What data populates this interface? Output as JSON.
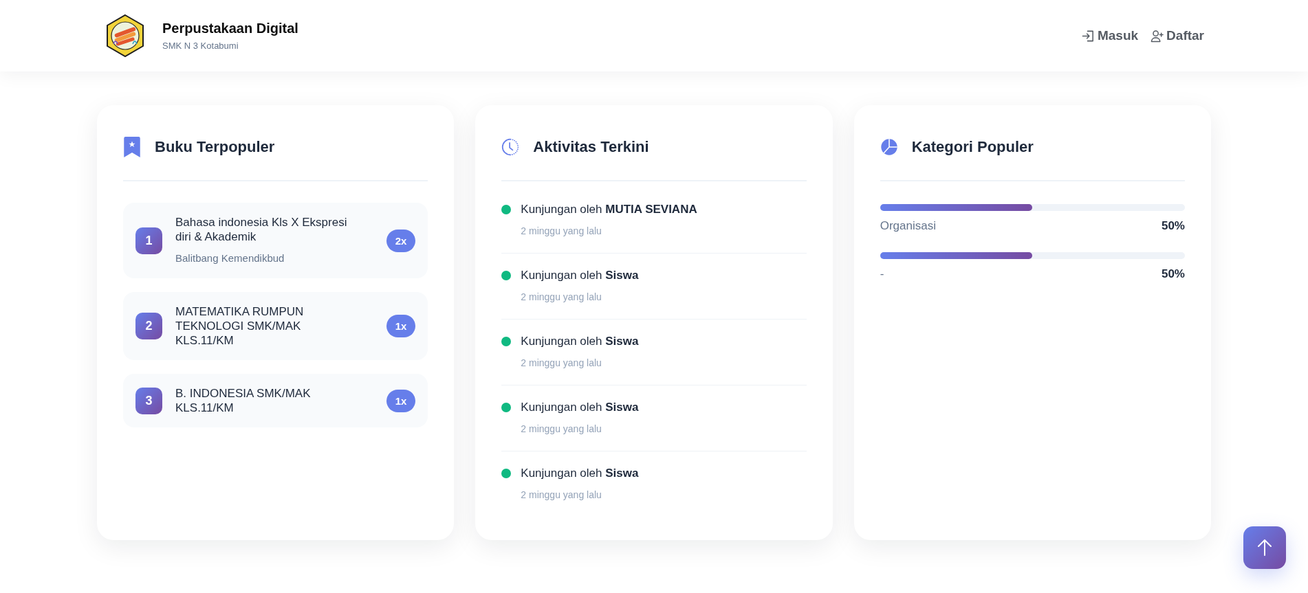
{
  "header": {
    "title": "Perpustakaan Digital",
    "subtitle": "SMK N 3 Kotabumi",
    "nav": [
      {
        "label": "Masuk",
        "kind": "login"
      },
      {
        "label": "Daftar",
        "kind": "register"
      }
    ]
  },
  "popular_books": {
    "title": "Buku Terpopuler",
    "items": [
      {
        "rank": "1",
        "title": "Bahasa indonesia Kls X Ekspresi diri & Akademik",
        "author": "Balitbang Kemendikbud",
        "count": "2x"
      },
      {
        "rank": "2",
        "title": "MATEMATIKA RUMPUN TEKNOLOGI SMK/MAK KLS.11/KM",
        "count": "1x"
      },
      {
        "rank": "3",
        "title": "B. INDONESIA SMK/MAK KLS.11/KM",
        "count": "1x"
      }
    ]
  },
  "recent_activity": {
    "title": "Aktivitas Terkini",
    "items": [
      {
        "text": "Kunjungan oleh **MUTIA SEVIANA**",
        "time": "2 minggu yang lalu"
      },
      {
        "text": "Kunjungan oleh **Siswa**",
        "time": "2 minggu yang lalu"
      },
      {
        "text": "Kunjungan oleh **Siswa**",
        "time": "2 minggu yang lalu"
      },
      {
        "text": "Kunjungan oleh **Siswa**",
        "time": "2 minggu yang lalu"
      },
      {
        "text": "Kunjungan oleh **Siswa**",
        "time": "2 minggu yang lalu"
      }
    ]
  },
  "popular_categories": {
    "title": "Kategori Populer",
    "items": [
      {
        "name": "Organisasi",
        "percent": "50%",
        "level": 0.5
      },
      {
        "name": "-",
        "percent": "50%",
        "level": 0.5
      }
    ]
  }
}
